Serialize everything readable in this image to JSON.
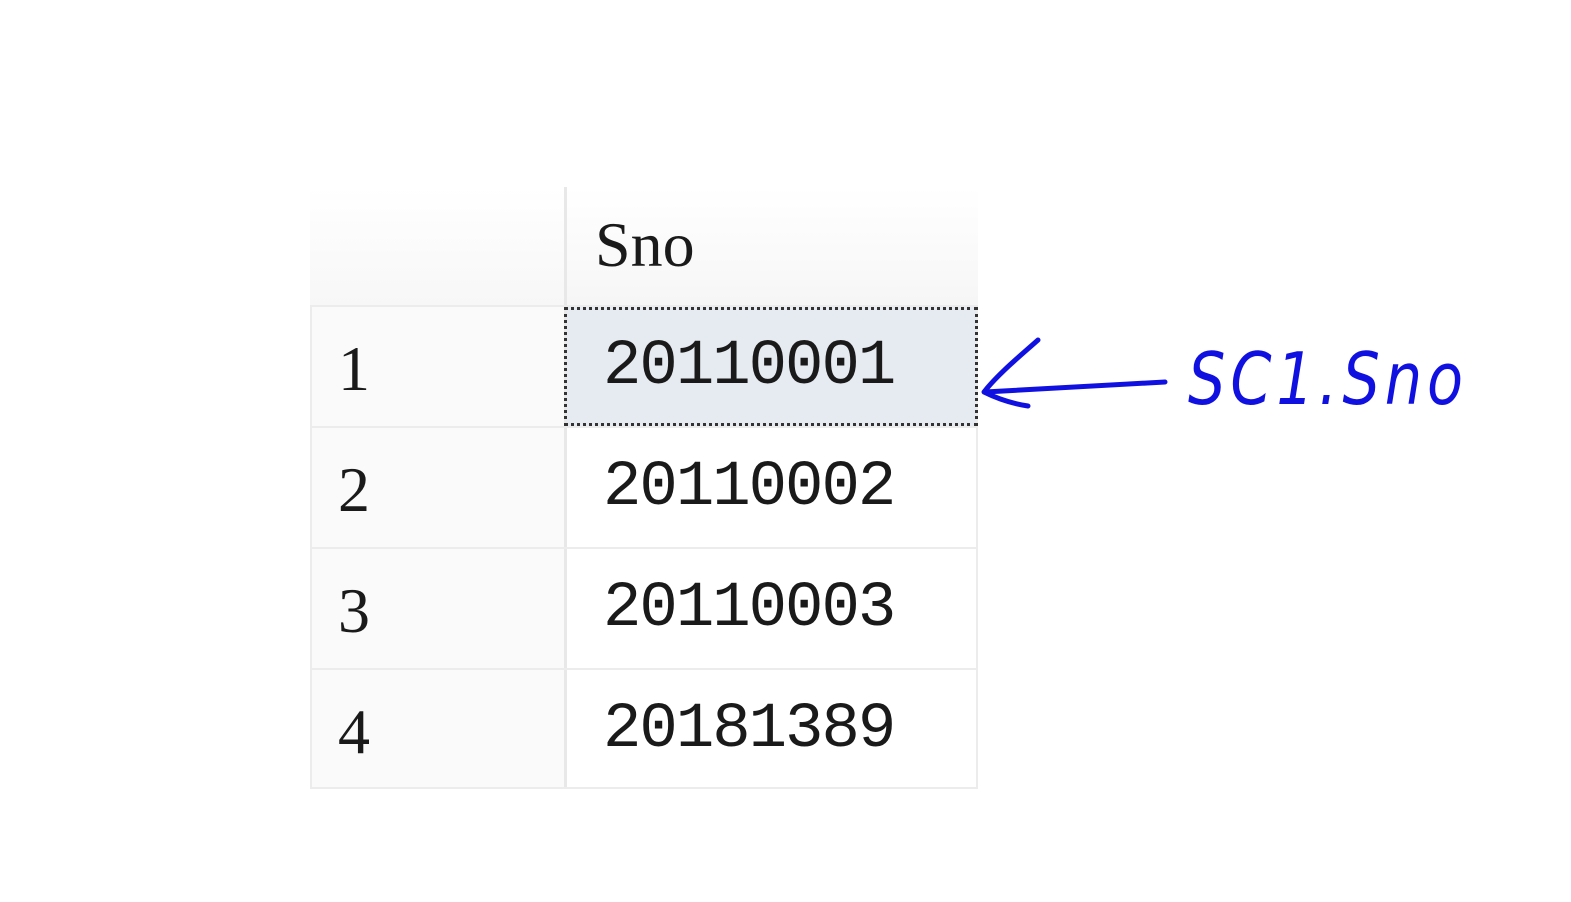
{
  "results_grid": {
    "column_header": "Sno",
    "rows": [
      {
        "row_number": "1",
        "sno": "20110001"
      },
      {
        "row_number": "2",
        "sno": "20110002"
      },
      {
        "row_number": "3",
        "sno": "20110003"
      },
      {
        "row_number": "4",
        "sno": "20181389"
      }
    ],
    "selected_row_number": "1"
  },
  "annotation": {
    "text": "SC1.Sno",
    "color": "#1010e0",
    "shape": "arrow-left"
  }
}
